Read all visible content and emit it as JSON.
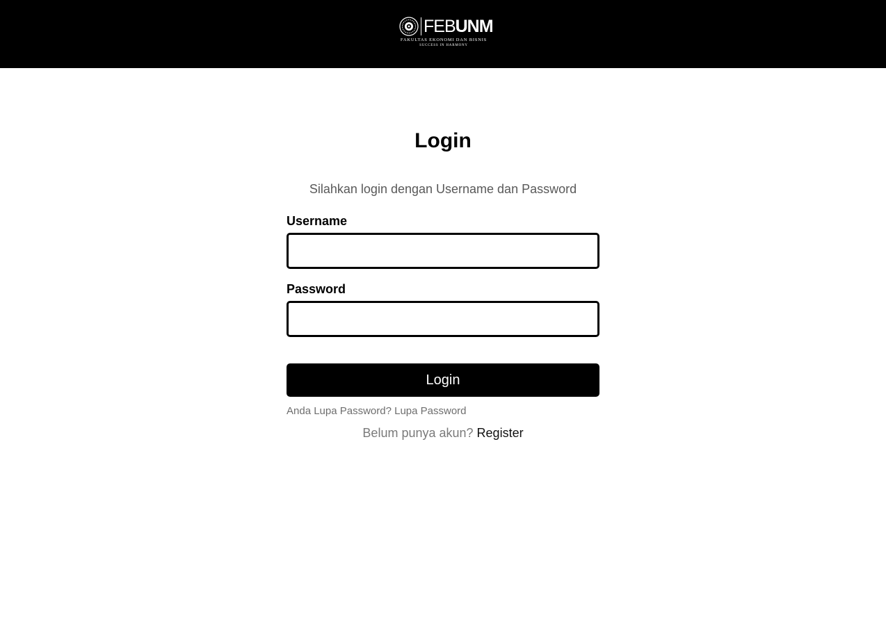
{
  "header": {
    "logo": {
      "word_light": "FEB",
      "word_bold": "UNM",
      "line1": "FAKULTAS EKONOMI DAN BISNIS",
      "line2": "SUCCESS IN HARMONY",
      "emblem_icon": "university-emblem-icon"
    },
    "background_color": "#000000"
  },
  "login": {
    "title": "Login",
    "subtitle": "Silahkan login dengan Username dan Password",
    "username_label": "Username",
    "username_value": "",
    "password_label": "Password",
    "password_value": "",
    "submit_label": "Login",
    "forgot_prefix": "Anda Lupa Password?",
    "forgot_link": "Lupa Password",
    "register_prefix": "Belum punya akun?",
    "register_link": "Register"
  },
  "colors": {
    "accent": "#000000",
    "muted_text": "#6e6e6e"
  }
}
